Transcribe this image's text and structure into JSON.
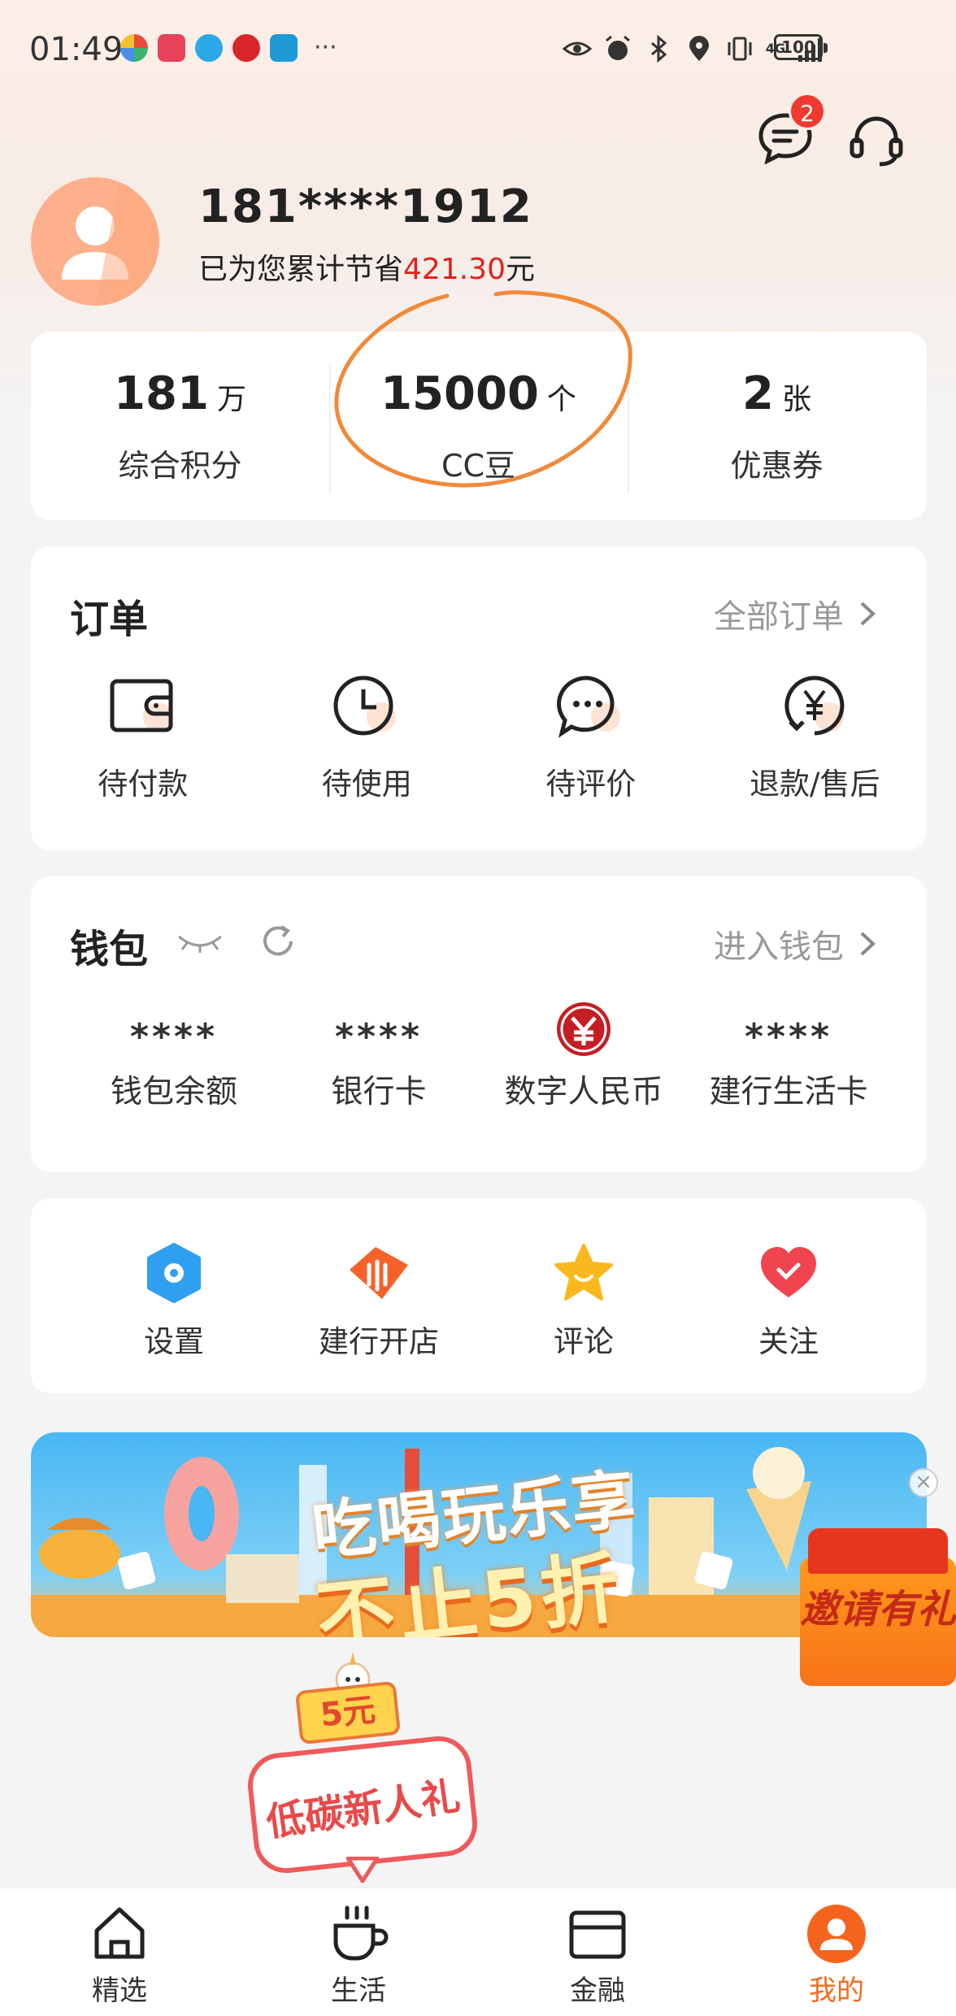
{
  "status_bar": {
    "time": "01:49",
    "more_dots": "···",
    "network": "4G",
    "battery": "100"
  },
  "header": {
    "message_badge": "2"
  },
  "profile": {
    "phone": "181****1912",
    "savings_prefix": "已为您累计节省",
    "savings_amount": "421.30",
    "savings_suffix": "元"
  },
  "stats": [
    {
      "value": "181",
      "unit": "万",
      "label": "综合积分"
    },
    {
      "value": "15000",
      "unit": "个",
      "label": "CC豆"
    },
    {
      "value": "2",
      "unit": "张",
      "label": "优惠券"
    }
  ],
  "orders": {
    "title": "订单",
    "all_link": "全部订单",
    "items": [
      {
        "label": "待付款",
        "icon": "wallet-icon"
      },
      {
        "label": "待使用",
        "icon": "clock-icon"
      },
      {
        "label": "待评价",
        "icon": "chat-bubble-icon"
      },
      {
        "label": "退款/售后",
        "icon": "refund-yen-icon"
      }
    ]
  },
  "wallet": {
    "title": "钱包",
    "enter_link": "进入钱包",
    "items": [
      {
        "value": "****",
        "label": "钱包余额"
      },
      {
        "value": "****",
        "label": "银行卡"
      },
      {
        "value": "",
        "label": "数字人民币"
      },
      {
        "value": "****",
        "label": "建行生活卡"
      }
    ]
  },
  "tools": [
    {
      "label": "设置",
      "icon": "settings-hexagon-icon"
    },
    {
      "label": "建行开店",
      "icon": "store-icon"
    },
    {
      "label": "评论",
      "icon": "star-icon"
    },
    {
      "label": "关注",
      "icon": "heart-icon"
    }
  ],
  "banner": {
    "line1": "吃喝玩乐享",
    "line2": "不止5折",
    "close": "×"
  },
  "invite": {
    "text": "邀请有礼"
  },
  "new_user_gift": {
    "tag": "5元",
    "text": "低碳新人礼"
  },
  "bottom_nav": [
    {
      "label": "精选",
      "icon": "home-icon",
      "active": false
    },
    {
      "label": "生活",
      "icon": "coffee-cup-icon",
      "active": false
    },
    {
      "label": "金融",
      "icon": "card-icon",
      "active": false
    },
    {
      "label": "我的",
      "icon": "user-icon",
      "active": true
    }
  ],
  "colors": {
    "accent": "#f26b1d",
    "savings_red": "#e3211b",
    "badge_red": "#f03a2f",
    "annotation_orange": "#f08a3a"
  }
}
